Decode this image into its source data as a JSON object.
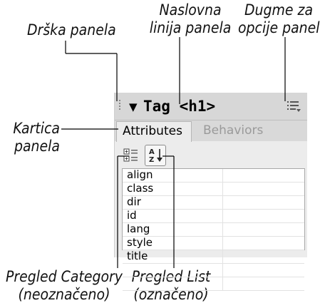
{
  "callouts": {
    "panel_gripper": "Drška panela",
    "title_bar": [
      "Naslovna",
      "linija panela"
    ],
    "options_button": [
      "Dugme za",
      "opcije panela"
    ],
    "panel_tab": [
      "Kartica",
      "panela"
    ],
    "category_view": [
      "Pregled Category",
      "(neoznačeno)"
    ],
    "list_view": [
      "Pregled List",
      "(označeno)"
    ]
  },
  "panel": {
    "title": "Tag <h1>",
    "tabs": [
      {
        "label": "Attributes",
        "active": true
      },
      {
        "label": "Behaviors",
        "active": false
      }
    ],
    "attributes": [
      "align",
      "class",
      "dir",
      "id",
      "lang",
      "style",
      "title",
      "",
      ""
    ]
  },
  "icons": {
    "gripper": "gripper-icon",
    "collapse": "triangle-down-icon",
    "options": "options-menu-icon",
    "category_view": "category-view-icon",
    "list_view": "sort-az-icon"
  }
}
